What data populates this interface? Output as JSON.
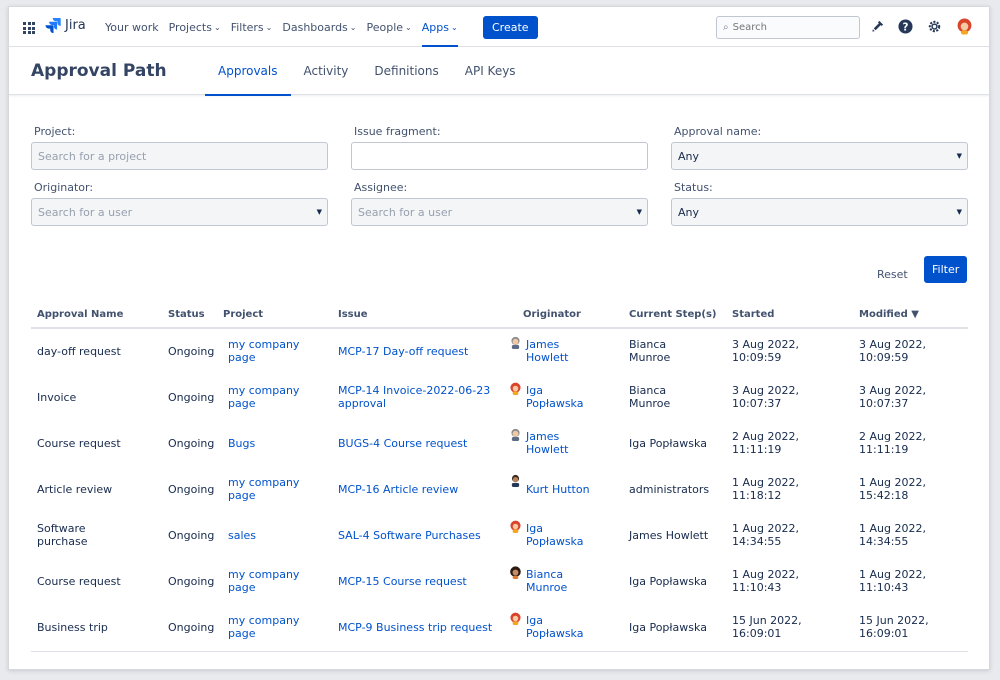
{
  "nav": {
    "product": "Jira",
    "items": [
      {
        "label": "Your work",
        "chev": ""
      },
      {
        "label": "Projects",
        "chev": "⌄"
      },
      {
        "label": "Filters",
        "chev": "⌄"
      },
      {
        "label": "Dashboards",
        "chev": "⌄"
      },
      {
        "label": "People",
        "chev": "⌄"
      },
      {
        "label": "Apps",
        "chev": "⌄"
      }
    ],
    "active_item": "Apps",
    "create_label": "Create",
    "search_placeholder": "Search",
    "icons": [
      "app-switcher-icon",
      "notifications-icon",
      "help-icon",
      "settings-icon",
      "profile-avatar"
    ]
  },
  "header": {
    "title": "Approval Path",
    "tabs": [
      "Approvals",
      "Activity",
      "Definitions",
      "API Keys"
    ],
    "active_tab": "Approvals"
  },
  "filters": {
    "project": {
      "label": "Project:",
      "placeholder": "Search for a project"
    },
    "issue_fragment": {
      "label": "Issue fragment:",
      "value": ""
    },
    "approval_name": {
      "label": "Approval name:",
      "value": "Any"
    },
    "originator": {
      "label": "Originator:",
      "placeholder": "Search for a user"
    },
    "assignee": {
      "label": "Assignee:",
      "placeholder": "Search for a user"
    },
    "status": {
      "label": "Status:",
      "value": "Any"
    },
    "reset_label": "Reset",
    "filter_label": "Filter"
  },
  "table": {
    "columns": [
      "Approval Name",
      "Status",
      "Project",
      "Issue",
      "Originator",
      "Current Step(s)",
      "Started",
      "Modified ▼"
    ],
    "rows": [
      {
        "name": [
          "day-off request"
        ],
        "status": "Ongoing",
        "project": [
          "my company",
          "page"
        ],
        "issue": [
          "MCP-17 Day-off request"
        ],
        "originator": [
          "James",
          "Howlett"
        ],
        "avatar": "james",
        "step": [
          "Bianca",
          "Munroe"
        ],
        "started": [
          "3 Aug 2022,",
          "10:09:59"
        ],
        "modified": [
          "3 Aug 2022,",
          "10:09:59"
        ]
      },
      {
        "name": [
          "Invoice"
        ],
        "status": "Ongoing",
        "project": [
          "my company",
          "page"
        ],
        "issue": [
          "MCP-14 Invoice-2022-06-23",
          "approval"
        ],
        "originator": [
          "Iga",
          "Popławska"
        ],
        "avatar": "iga",
        "step": [
          "Bianca",
          "Munroe"
        ],
        "started": [
          "3 Aug 2022,",
          "10:07:37"
        ],
        "modified": [
          "3 Aug 2022,",
          "10:07:37"
        ]
      },
      {
        "name": [
          "Course request"
        ],
        "status": "Ongoing",
        "project": [
          "Bugs"
        ],
        "issue": [
          "BUGS-4 Course request"
        ],
        "originator": [
          "James",
          "Howlett"
        ],
        "avatar": "james",
        "step": [
          "Iga Popławska"
        ],
        "started": [
          "2 Aug 2022,",
          "11:11:19"
        ],
        "modified": [
          "2 Aug 2022,",
          "11:11:19"
        ]
      },
      {
        "name": [
          "Article review"
        ],
        "status": "Ongoing",
        "project": [
          "my company",
          "page"
        ],
        "issue": [
          "MCP-16 Article review"
        ],
        "originator": [
          "Kurt Hutton"
        ],
        "avatar": "kurt",
        "step": [
          "administrators"
        ],
        "started": [
          "1 Aug 2022,",
          "11:18:12"
        ],
        "modified": [
          "1 Aug 2022,",
          "15:42:18"
        ]
      },
      {
        "name": [
          "Software",
          "purchase"
        ],
        "status": "Ongoing",
        "project": [
          "sales"
        ],
        "issue": [
          "SAL-4 Software Purchases"
        ],
        "originator": [
          "Iga",
          "Popławska"
        ],
        "avatar": "iga",
        "step": [
          "James Howlett"
        ],
        "started": [
          "1 Aug 2022,",
          "14:34:55"
        ],
        "modified": [
          "1 Aug 2022,",
          "14:34:55"
        ]
      },
      {
        "name": [
          "Course request"
        ],
        "status": "Ongoing",
        "project": [
          "my company",
          "page"
        ],
        "issue": [
          "MCP-15 Course request"
        ],
        "originator": [
          "Bianca",
          "Munroe"
        ],
        "avatar": "bianca",
        "step": [
          "Iga Popławska"
        ],
        "started": [
          "1 Aug 2022,",
          "11:10:43"
        ],
        "modified": [
          "1 Aug 2022,",
          "11:10:43"
        ]
      },
      {
        "name": [
          "Business trip"
        ],
        "status": "Ongoing",
        "project": [
          "my company",
          "page"
        ],
        "issue": [
          "MCP-9 Business trip request"
        ],
        "originator": [
          "Iga",
          "Popławska"
        ],
        "avatar": "iga",
        "step": [
          "Iga Popławska"
        ],
        "started": [
          "15 Jun 2022,",
          "16:09:01"
        ],
        "modified": [
          "15 Jun 2022,",
          "16:09:01"
        ]
      }
    ]
  },
  "colors": {
    "accent": "#0052cc",
    "text": "#172b4d",
    "muted": "#42526e",
    "border": "#dfe1e6"
  }
}
